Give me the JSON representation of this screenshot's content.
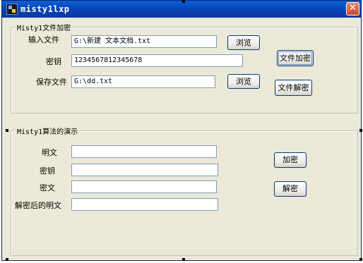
{
  "window": {
    "title": "misty1lxp",
    "close_symbol": "✕"
  },
  "file_group": {
    "title": "Misty1文件加密",
    "input_file_label": "输入文件",
    "input_file_value": "G:\\新建 文本文档.txt",
    "key_label": "密钥",
    "key_value": "1234567812345678",
    "save_file_label": "保存文件",
    "save_file_value": "G:\\dd.txt",
    "browse_label": "浏览",
    "encrypt_file_label": "文件加密",
    "decrypt_file_label": "文件解密"
  },
  "demo_group": {
    "title": "Misty1算法的演示",
    "plaintext_label": "明文",
    "plaintext_value": "",
    "key_label": "密钥",
    "key_value": "",
    "ciphertext_label": "密文",
    "ciphertext_value": "",
    "decrypted_label": "解密后的明文",
    "decrypted_value": "",
    "encrypt_label": "加密",
    "decrypt_label": "解密"
  }
}
